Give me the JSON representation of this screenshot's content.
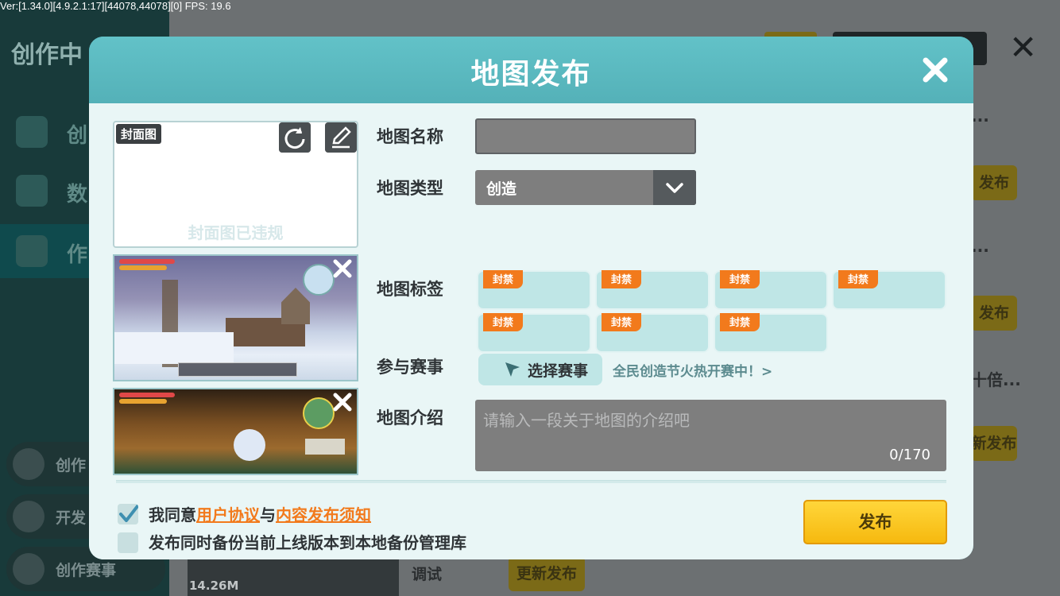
{
  "debug_overlay": "Ver:[1.34.0][4.9.2.1:17][44078,44078][0] FPS: 19.6",
  "background": {
    "title": "创作中",
    "nav": [
      "创",
      "数",
      "作"
    ],
    "side_items": [
      "创作",
      "开发",
      "创作赛事"
    ],
    "right_buttons": [
      "发布",
      "发布",
      "新发布",
      "更新发布"
    ],
    "truncated_texts": [
      "...",
      "...",
      "十倍..."
    ],
    "debug_label": "调试",
    "file_size": "14.26M"
  },
  "dialog": {
    "title": "地图发布",
    "cover": {
      "tag": "封面图",
      "warning": "封面图已违规"
    },
    "form": {
      "name_label": "地图名称",
      "name_value": "",
      "type_label": "地图类型",
      "type_value": "创造",
      "tags_label": "地图标签",
      "tags": [
        "封禁",
        "封禁",
        "封禁",
        "封禁",
        "封禁",
        "封禁",
        "封禁"
      ],
      "contest_label": "参与赛事",
      "contest_button": "选择赛事",
      "contest_link": "全民创造节火热开赛中！>",
      "intro_label": "地图介绍",
      "intro_placeholder": "请输入一段关于地图的介绍吧",
      "intro_count": "0/170"
    },
    "agreement": {
      "prefix": "我同意",
      "link1": "用户协议",
      "joiner": "与",
      "link2": "内容发布须知",
      "checked": true
    },
    "backup": {
      "label": "发布同时备份当前上线版本到本地备份管理库",
      "checked": false
    },
    "publish_button": "发布"
  },
  "colors": {
    "header": "#5bb9c0",
    "accent_orange": "#f27a1c",
    "publish_yellow": "#ffd63a",
    "tag_bg": "#bfe6e6"
  }
}
